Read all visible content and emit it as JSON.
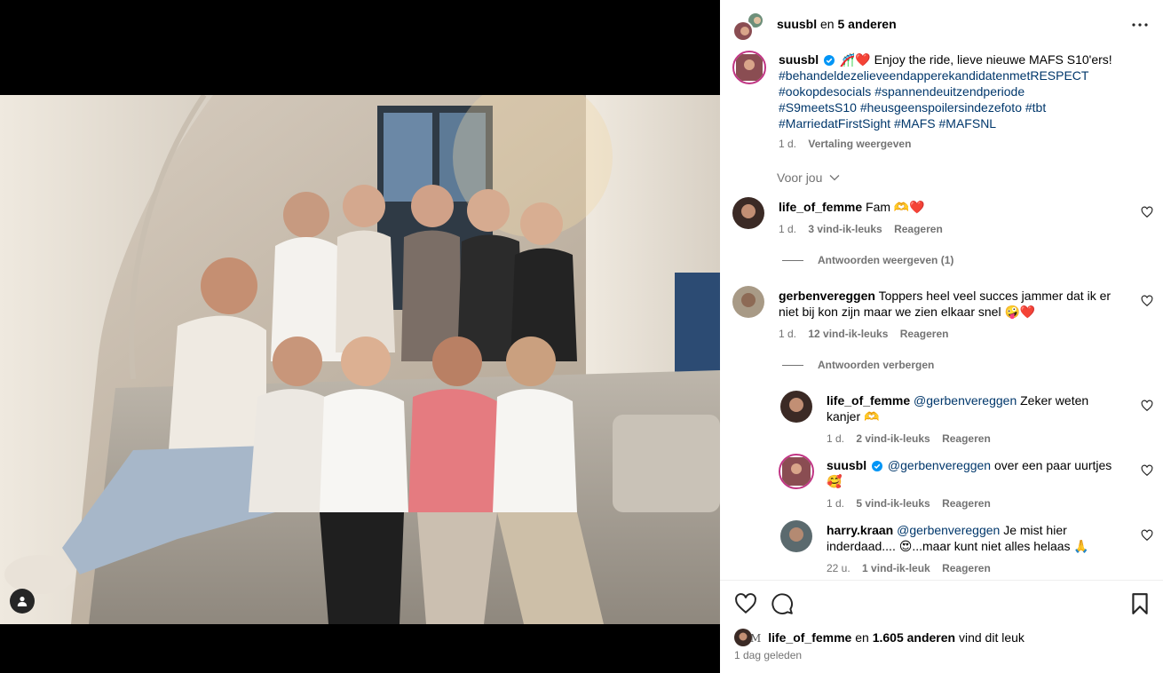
{
  "header": {
    "username": "suusbl",
    "joiner": "en",
    "others": "5 anderen"
  },
  "caption": {
    "username": "suusbl",
    "emoji": "🎢❤️",
    "text": "Enjoy the ride, lieve nieuwe MAFS S10'ers!",
    "hashtags_line1": "#behandeldezelieveendapperekandidatenmetRESPECT",
    "hashtags_line2a": "#ookopdesocials",
    "hashtags_line2b": "#spannendeuitzendperiode",
    "hashtags_line3a": "#S9meetsS10",
    "hashtags_line3b": "#heusgeenspoilersindezefoto",
    "hashtags_line3c": "#tbt",
    "hashtags_line4a": "#MarriedatFirstSight",
    "hashtags_line4b": "#MAFS",
    "hashtags_line4c": "#MAFSNL",
    "time": "1 d.",
    "translate": "Vertaling weergeven"
  },
  "sort_label": "Voor jou",
  "comments": [
    {
      "username": "life_of_femme",
      "text": "Fam 🫶❤️",
      "time": "1 d.",
      "likes": "3 vind-ik-leuks",
      "reply": "Reageren",
      "toggle": "Antwoorden weergeven (1)"
    },
    {
      "username": "gerbenvereggen",
      "text": "Toppers heel veel succes jammer dat ik er",
      "text2": "niet bij kon zijn maar we zien elkaar snel 🤪❤️",
      "time": "1 d.",
      "likes": "12 vind-ik-leuks",
      "reply": "Reageren",
      "toggle": "Antwoorden verbergen"
    }
  ],
  "replies": [
    {
      "username": "life_of_femme",
      "mention": "@gerbenvereggen",
      "text": "Zeker weten",
      "text2": "kanjer 🫶",
      "time": "1 d.",
      "likes": "2 vind-ik-leuks",
      "reply": "Reageren"
    },
    {
      "username": "suusbl",
      "mention": "@gerbenvereggen",
      "text": "over een paar uurtjes",
      "text2": "🥰",
      "time": "1 d.",
      "likes": "5 vind-ik-leuks",
      "reply": "Reageren"
    },
    {
      "username": "harry.kraan",
      "mention": "@gerbenvereggen",
      "text": "Je mist hier",
      "text2": "inderdaad.... 😍...maar kunt niet alles helaas 🙏",
      "time": "22 u.",
      "likes": "1 vind-ik-leuk",
      "reply": "Reageren"
    }
  ],
  "likes_bar": {
    "mini_letter": "M",
    "username": "life_of_femme",
    "joiner": "en",
    "count": "1.605 anderen",
    "suffix": "vind dit leuk",
    "date": "1 dag geleden"
  },
  "icons": {
    "tag": "person-tag-icon",
    "more": "more-horizontal-icon",
    "verified": "verified-badge-icon",
    "like": "heart-icon",
    "comment": "comment-bubble-icon",
    "save": "bookmark-icon"
  },
  "colors": {
    "link": "#00376b",
    "muted": "#737373",
    "verified": "#0095f6"
  }
}
